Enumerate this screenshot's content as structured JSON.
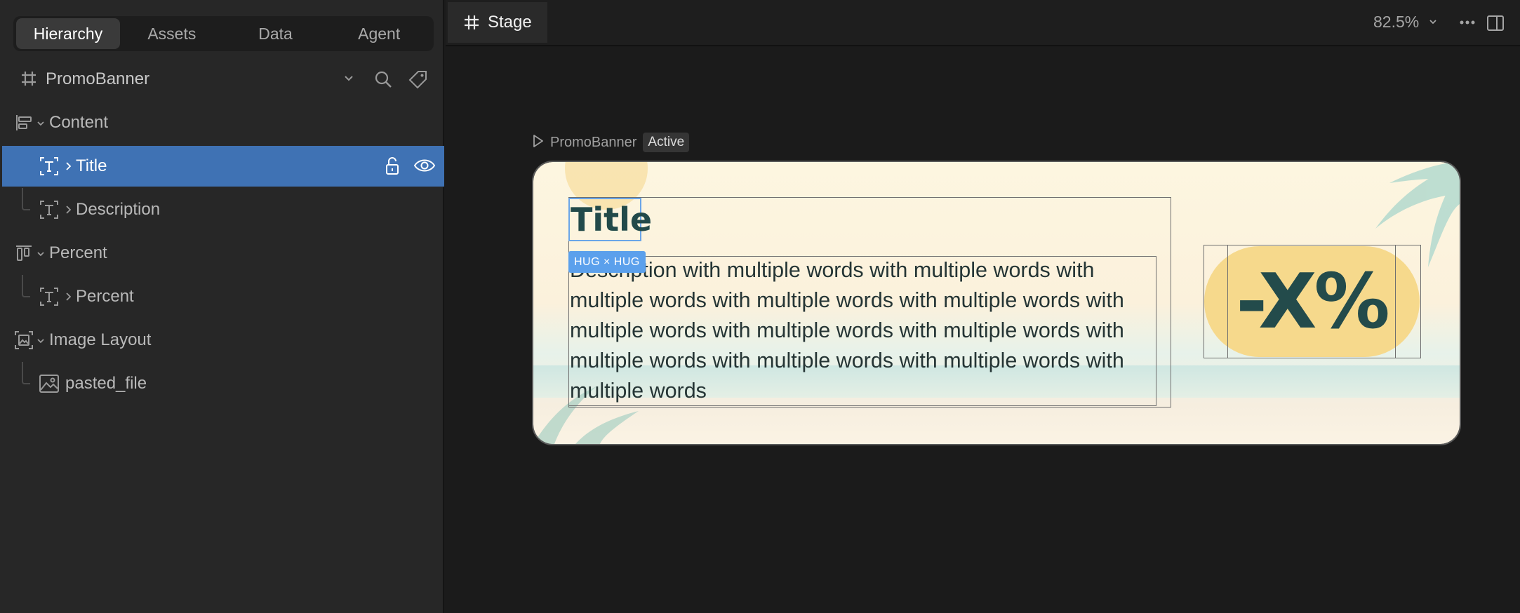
{
  "left_panel": {
    "tabs": [
      {
        "label": "Hierarchy",
        "active": true
      },
      {
        "label": "Assets",
        "active": false
      },
      {
        "label": "Data",
        "active": false
      },
      {
        "label": "Agent",
        "active": false
      }
    ],
    "component": {
      "name": "PromoBanner",
      "icon": "frame-hash-icon"
    },
    "tree": [
      {
        "label": "Content",
        "icon": "horizontal-layout-icon",
        "level": 0,
        "expanded": true
      },
      {
        "label": "Title",
        "icon": "text-icon",
        "level": 1,
        "selected": true
      },
      {
        "label": "Description",
        "icon": "text-icon",
        "level": 1
      },
      {
        "label": "Percent",
        "icon": "vertical-layout-icon",
        "level": 0,
        "expanded": true
      },
      {
        "label": "Percent",
        "icon": "text-icon",
        "level": 1
      },
      {
        "label": "Image Layout",
        "icon": "image-layout-icon",
        "level": 0,
        "expanded": true
      },
      {
        "label": "pasted_file",
        "icon": "image-icon",
        "level": 1
      }
    ]
  },
  "stage": {
    "tab_label": "Stage",
    "zoom": "82.5%",
    "frame_name": "PromoBanner",
    "frame_state": "Active",
    "banner": {
      "title": "Title",
      "size_badge": "HUG × HUG",
      "description": "Description with multiple words with multiple words with multiple words with multiple words with multiple words with multiple words with multiple words with multiple words with multiple words with multiple words with multiple words with multiple words",
      "percent": "-X%"
    }
  },
  "colors": {
    "selection": "#3f72b4",
    "accent_blue": "#5ba0ec",
    "banner_text": "#234b4b",
    "pill": "#f6d98c"
  }
}
